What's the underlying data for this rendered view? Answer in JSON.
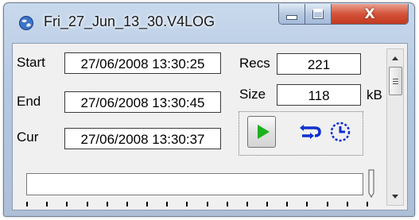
{
  "window": {
    "title": "Fri_27_Jun_13_30.V4LOG",
    "buttons": {
      "minimize": "minimize",
      "maximize": "maximize",
      "close": "X"
    }
  },
  "fields": {
    "start_label": "Start",
    "start_value": "27/06/2008 13:30:25",
    "end_label": "End",
    "end_value": "27/06/2008 13:30:45",
    "cur_label": "Cur",
    "cur_value": "27/06/2008 13:30:37",
    "recs_label": "Recs",
    "recs_value": "221",
    "size_label": "Size",
    "size_value": "118",
    "size_unit": "kB"
  },
  "controls": {
    "play_icon": "play-icon",
    "loop_icon": "loop-arrows-icon",
    "clock_icon": "timer-clock-icon"
  },
  "slider": {
    "position_fraction": 1.0,
    "tick_count": 18
  },
  "colors": {
    "play_green": "#1db11d",
    "icon_blue": "#1030d0",
    "close_red": "#c23a20"
  }
}
